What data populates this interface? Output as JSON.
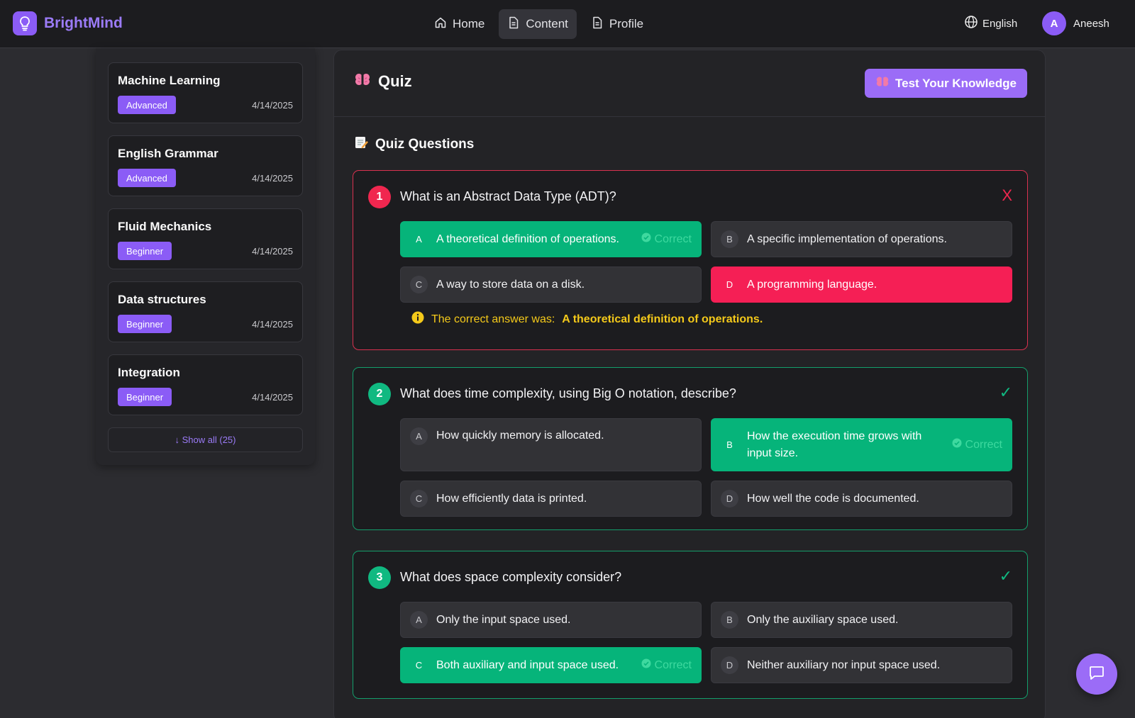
{
  "brand": {
    "name": "BrightMind"
  },
  "nav": [
    {
      "label": "Home",
      "icon": "home-icon",
      "active": false
    },
    {
      "label": "Content",
      "icon": "document-icon",
      "active": true
    },
    {
      "label": "Profile",
      "icon": "document-icon",
      "active": false
    }
  ],
  "language": {
    "label": "English"
  },
  "user": {
    "initial": "A",
    "name": "Aneesh"
  },
  "sidebar": {
    "topics": [
      {
        "title": "Machine Learning",
        "level": "Advanced",
        "date": "4/14/2025"
      },
      {
        "title": "English Grammar",
        "level": "Advanced",
        "date": "4/14/2025"
      },
      {
        "title": "Fluid Mechanics",
        "level": "Beginner",
        "date": "4/14/2025"
      },
      {
        "title": "Data structures",
        "level": "Beginner",
        "date": "4/14/2025"
      },
      {
        "title": "Integration",
        "level": "Beginner",
        "date": "4/14/2025"
      }
    ],
    "show_all": "↓ Show all (25)"
  },
  "quiz": {
    "title": "Quiz",
    "test_button": "Test Your Knowledge",
    "questions_heading": "Quiz Questions",
    "correct_tag": "Correct",
    "hint_prefix": "The correct answer was:",
    "questions": [
      {
        "number": "1",
        "text": "What is an Abstract Data Type (ADT)?",
        "result_mark": "X",
        "options": [
          {
            "letter": "A",
            "text": "A theoretical definition of operations."
          },
          {
            "letter": "B",
            "text": "A specific implementation of operations."
          },
          {
            "letter": "C",
            "text": "A way to store data on a disk."
          },
          {
            "letter": "D",
            "text": "A programming language."
          }
        ],
        "hint_answer": "A theoretical definition of operations."
      },
      {
        "number": "2",
        "text": "What does time complexity, using Big O notation, describe?",
        "result_mark": "✓",
        "options": [
          {
            "letter": "A",
            "text": "How quickly memory is allocated."
          },
          {
            "letter": "B",
            "text": "How the execution time grows with input size."
          },
          {
            "letter": "C",
            "text": "How efficiently data is printed."
          },
          {
            "letter": "D",
            "text": "How well the code is documented."
          }
        ]
      },
      {
        "number": "3",
        "text": "What does space complexity consider?",
        "result_mark": "✓",
        "options": [
          {
            "letter": "A",
            "text": "Only the input space used."
          },
          {
            "letter": "B",
            "text": "Only the auxiliary space used."
          },
          {
            "letter": "C",
            "text": "Both auxiliary and input space used."
          },
          {
            "letter": "D",
            "text": "Neither auxiliary nor input space used."
          }
        ]
      }
    ]
  },
  "colors": {
    "accent": "#8b5cf6",
    "correct": "#06b47a",
    "wrong": "#f51f55",
    "hint": "#f4c91a"
  }
}
